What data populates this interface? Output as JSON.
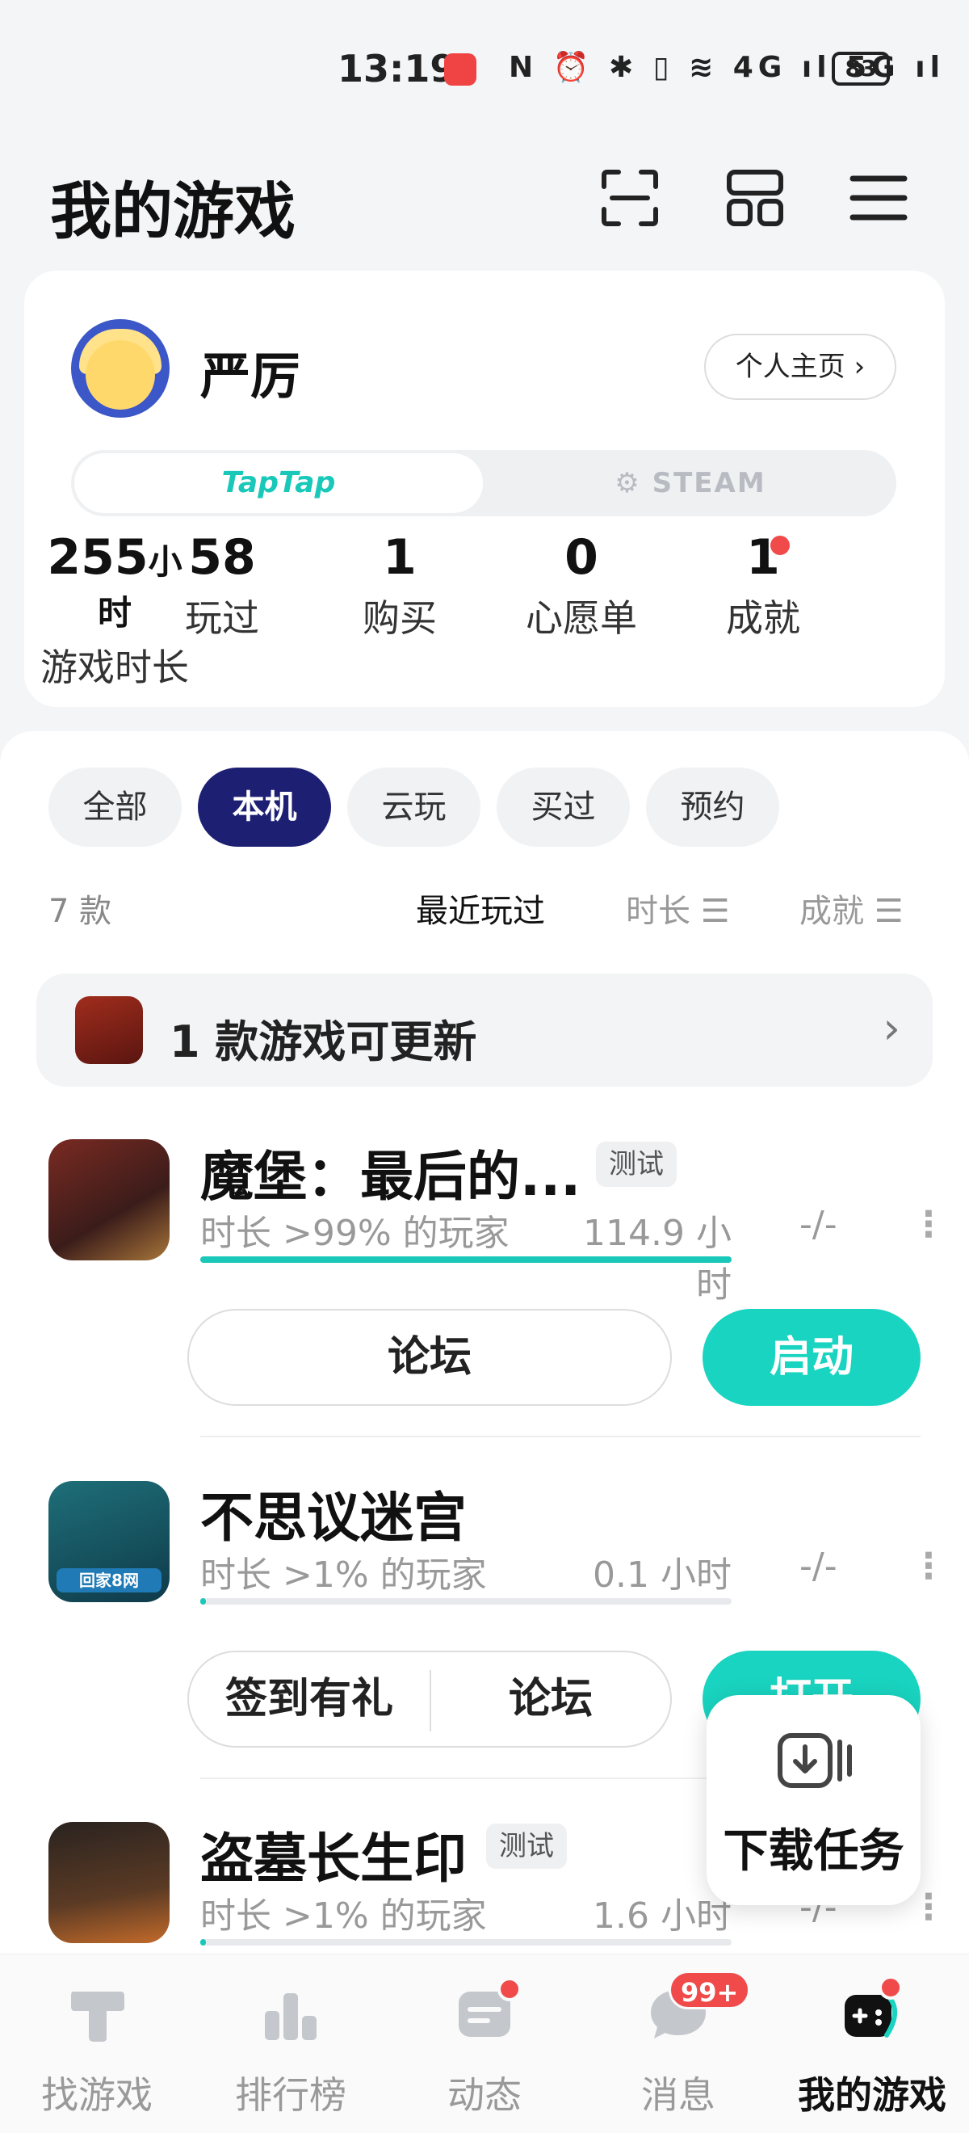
{
  "status_bar": {
    "time": "13:19",
    "icons": "N ⏰ ✱ ▯ ≋ 4G ıl 5G ıl",
    "battery": "83"
  },
  "header": {
    "title": "我的游戏"
  },
  "profile": {
    "username": "严厉",
    "homepage_label": "个人主页 ›",
    "platform_tabs": [
      "TapTap",
      "STEAM"
    ],
    "stats": [
      {
        "value": "255",
        "unit": "小时",
        "label": "游戏时长"
      },
      {
        "value": "58",
        "unit": "",
        "label": "玩过"
      },
      {
        "value": "1",
        "unit": "",
        "label": "购买"
      },
      {
        "value": "0",
        "unit": "",
        "label": "心愿单"
      },
      {
        "value": "1",
        "unit": "",
        "label": "成就"
      }
    ]
  },
  "filters": {
    "chips": [
      "全部",
      "本机",
      "云玩",
      "买过",
      "预约"
    ],
    "active": "本机"
  },
  "list": {
    "count": "7 款",
    "sort_options": [
      "最近玩过",
      "时长 ☰",
      "成就 ☰"
    ],
    "update_bar": {
      "text": "1 款游戏可更新",
      "chevron": "›"
    }
  },
  "games": [
    {
      "name": "魔堡：最后的...",
      "tag": "测试",
      "meta": "时长 >99% 的玩家",
      "hours": "114.9 小时",
      "achievement": "-/-",
      "more": "⋮",
      "progress": 1.0,
      "buttons": [
        "论坛"
      ],
      "primary": "启动"
    },
    {
      "name": "不思议迷宫",
      "tag": "",
      "meta": "时长 >1% 的玩家",
      "hours": "0.1 小时",
      "achievement": "-/-",
      "more": "⋮",
      "progress": 0.01,
      "buttons": [
        "签到有礼",
        "论坛"
      ],
      "primary": "打开",
      "icon_text": "回家8网"
    },
    {
      "name": "盗墓长生印",
      "tag": "测试",
      "meta": "时长 >1% 的玩家",
      "hours": "1.6 小时",
      "achievement": "-/-",
      "more": "⋮",
      "progress": 0.01
    }
  ],
  "download_panel": {
    "label": "下载任务"
  },
  "bottom_nav": {
    "items": [
      "找游戏",
      "排行榜",
      "动态",
      "消息",
      "我的游戏"
    ],
    "message_badge": "99+",
    "active": "我的游戏"
  },
  "colors": {
    "accent": "#19d4c0",
    "chip_active": "#1d1f73",
    "badge": "#f04a4a"
  }
}
